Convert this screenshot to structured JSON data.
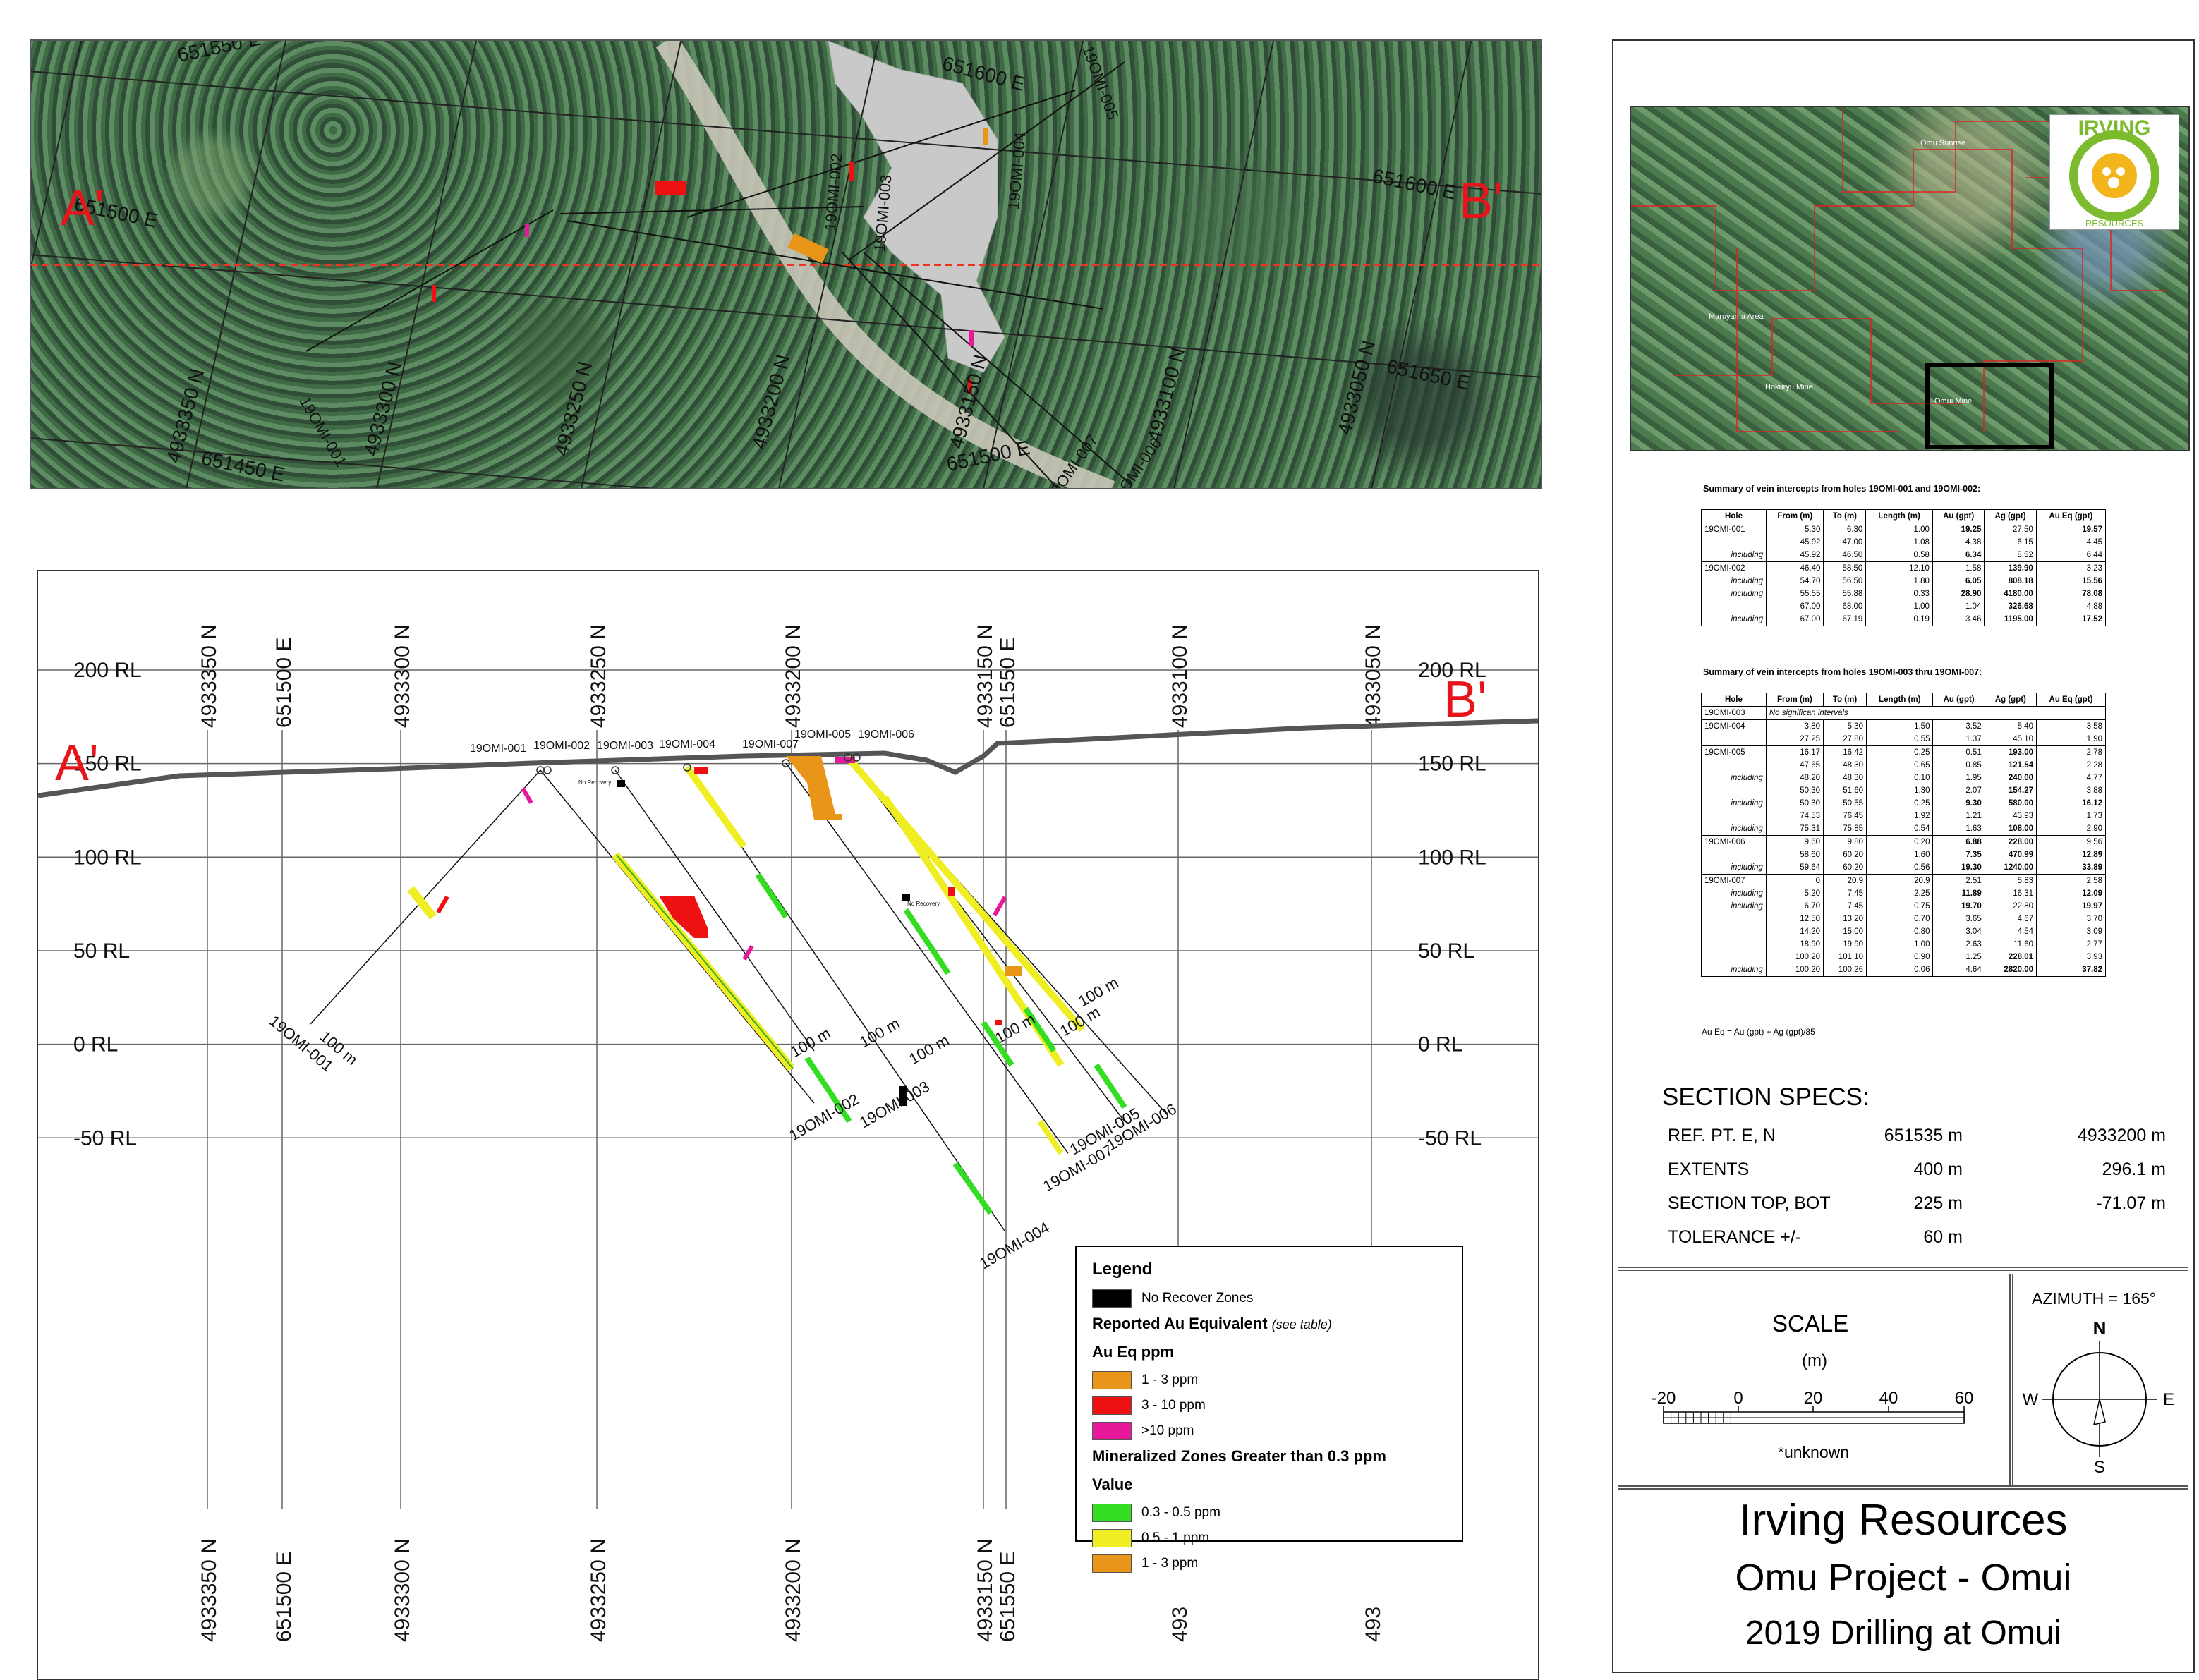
{
  "plan_map": {
    "section_start": "A'",
    "section_end": "B'",
    "grid_labels": [
      "651550 E",
      "651600 E",
      "651500 E",
      "651450 E",
      "651650 E",
      "4933350 N",
      "4933300 N",
      "4933250 N",
      "4933200 N",
      "4933150 N",
      "4933100 N",
      "4933050 N",
      "651500 E",
      "651600 E"
    ],
    "hole_labels": [
      "19OMI-001",
      "19OMI-002",
      "19OMI-003",
      "19OMI-004",
      "19OMI-005",
      "19OMI-006",
      "19OMI-007"
    ]
  },
  "section": {
    "start_label": "A'",
    "end_label": "B'",
    "rl_labels": [
      {
        "text": "200 RL",
        "rl": 200
      },
      {
        "text": "150 RL",
        "rl": 150
      },
      {
        "text": "100 RL",
        "rl": 100
      },
      {
        "text": "50 RL",
        "rl": 50
      },
      {
        "text": "0 RL",
        "rl": 0
      },
      {
        "text": "-50 RL",
        "rl": -50
      }
    ],
    "grid_labels": [
      "4933350 N",
      "651500 E",
      "4933300 N",
      "4933250 N",
      "4933200 N",
      "4933150 N",
      "651550 E",
      "4933100 N",
      "4933050 N"
    ],
    "bottom_grid_labels": [
      "4933350 N",
      "651500 E",
      "4933300 N",
      "4933250 N",
      "4933200 N",
      "4933150 N",
      "651550 E",
      "493",
      "493"
    ],
    "collar_labels": [
      "19OMI-001",
      "19OMI-002",
      "19OMI-003",
      "19OMI-004",
      "19OMI-007",
      "19OMI-005",
      "19OMI-006"
    ],
    "end_labels": [
      "19OMI-001",
      "19OMI-002",
      "19OMI-003",
      "19OMI-004",
      "19OMI-007",
      "19OMI-005",
      "19OMI-006"
    ],
    "depth_label": "100 m",
    "no_recovery": "No Recovery"
  },
  "legend": {
    "title": "Legend",
    "no_recover": "No Recover Zones",
    "au_title": "Reported Au Equivalent",
    "au_note": "(see table)",
    "au_sub": "Au Eq ppm",
    "au_items": [
      {
        "label": "1 - 3 ppm",
        "color": "#e8951a"
      },
      {
        "label": "3 - 10 ppm",
        "color": "#ee1111"
      },
      {
        "label": ">10 ppm",
        "color": "#e8189a"
      }
    ],
    "min_title": "Mineralized Zones Greater than 0.3 ppm",
    "min_sub": "Value",
    "min_items": [
      {
        "label": "0.3 - 0.5 ppm",
        "color": "#33dd22"
      },
      {
        "label": "0.5 - 1  ppm",
        "color": "#eeee22"
      },
      {
        "label": "1 - 3 ppm",
        "color": "#e8951a"
      }
    ]
  },
  "location_map": {
    "labels": [
      "Omu Sunrise",
      "Maruyama Area",
      "Hokuryu Mine",
      "Omui Mine"
    ],
    "logo_text": "IRVING",
    "logo_sub": "RESOURCES"
  },
  "table1": {
    "title": "Summary of vein intercepts from holes 19OMI-001 and 19OMI-002:",
    "headers": [
      "Hole",
      "From (m)",
      "To (m)",
      "Length (m)",
      "Au (gpt)",
      "Ag (gpt)",
      "Au Eq (gpt)"
    ],
    "rows": [
      [
        "19OMI-001",
        "5.30",
        "6.30",
        "1.00",
        "19.25",
        "27.50",
        "19.57"
      ],
      [
        "",
        "45.92",
        "47.00",
        "1.08",
        "4.38",
        "6.15",
        "4.45"
      ],
      [
        "including",
        "45.92",
        "46.50",
        "0.58",
        "6.34",
        "8.52",
        "6.44"
      ],
      [
        "19OMI-002",
        "46.40",
        "58.50",
        "12.10",
        "1.58",
        "139.90",
        "3.23"
      ],
      [
        "including",
        "54.70",
        "56.50",
        "1.80",
        "6.05",
        "808.18",
        "15.56"
      ],
      [
        "including",
        "55.55",
        "55.88",
        "0.33",
        "28.90",
        "4180.00",
        "78.08"
      ],
      [
        "",
        "67.00",
        "68.00",
        "1.00",
        "1.04",
        "326.68",
        "4.88"
      ],
      [
        "including",
        "67.00",
        "67.19",
        "0.19",
        "3.46",
        "1195.00",
        "17.52"
      ]
    ]
  },
  "table2": {
    "title": "Summary of vein intercepts from holes 19OMI-003 thru 19OMI-007:",
    "headers": [
      "Hole",
      "From (m)",
      "To (m)",
      "Length (m)",
      "Au (gpt)",
      "Ag (gpt)",
      "Au Eq (gpt)"
    ],
    "no_sig": "No significan intervals",
    "rows": [
      [
        "19OMI-004",
        "3.80",
        "5.30",
        "1.50",
        "3.52",
        "5.40",
        "3.58"
      ],
      [
        "",
        "27.25",
        "27.80",
        "0.55",
        "1.37",
        "45.10",
        "1.90"
      ],
      [
        "19OMI-005",
        "16.17",
        "16.42",
        "0.25",
        "0.51",
        "193.00",
        "2.78"
      ],
      [
        "",
        "47.65",
        "48.30",
        "0.65",
        "0.85",
        "121.54",
        "2.28"
      ],
      [
        "including",
        "48.20",
        "48.30",
        "0.10",
        "1.95",
        "240.00",
        "4.77"
      ],
      [
        "",
        "50.30",
        "51.60",
        "1.30",
        "2.07",
        "154.27",
        "3.88"
      ],
      [
        "including",
        "50.30",
        "50.55",
        "0.25",
        "9.30",
        "580.00",
        "16.12"
      ],
      [
        "",
        "74.53",
        "76.45",
        "1.92",
        "1.21",
        "43.93",
        "1.73"
      ],
      [
        "including",
        "75.31",
        "75.85",
        "0.54",
        "1.63",
        "108.00",
        "2.90"
      ],
      [
        "19OMI-006",
        "9.60",
        "9.80",
        "0.20",
        "6.88",
        "228.00",
        "9.56"
      ],
      [
        "",
        "58.60",
        "60.20",
        "1.60",
        "7.35",
        "470.99",
        "12.89"
      ],
      [
        "including",
        "59.64",
        "60.20",
        "0.56",
        "19.30",
        "1240.00",
        "33.89"
      ],
      [
        "19OMI-007",
        "0",
        "20.9",
        "20.9",
        "2.51",
        "5.83",
        "2.58"
      ],
      [
        "including",
        "5.20",
        "7.45",
        "2.25",
        "11.89",
        "16.31",
        "12.09"
      ],
      [
        "including",
        "6.70",
        "7.45",
        "0.75",
        "19.70",
        "22.80",
        "19.97"
      ],
      [
        "",
        "12.50",
        "13.20",
        "0.70",
        "3.65",
        "4.67",
        "3.70"
      ],
      [
        "",
        "14.20",
        "15.00",
        "0.80",
        "3.04",
        "4.54",
        "3.09"
      ],
      [
        "",
        "18.90",
        "19.90",
        "1.00",
        "2.63",
        "11.60",
        "2.77"
      ],
      [
        "",
        "100.20",
        "101.10",
        "0.90",
        "1.25",
        "228.01",
        "3.93"
      ],
      [
        "including",
        "100.20",
        "100.26",
        "0.06",
        "4.64",
        "2820.00",
        "37.82"
      ]
    ],
    "footnote": "Au Eq = Au (gpt) + Ag (gpt)/85"
  },
  "specs": {
    "title": "SECTION  SPECS:",
    "rows": [
      {
        "label": "REF. PT.  E, N",
        "a": "651535 m",
        "b": "4933200 m"
      },
      {
        "label": "EXTENTS",
        "a": "400 m",
        "b": "296.1 m"
      },
      {
        "label": "SECTION TOP, BOT",
        "a": "225 m",
        "b": "-71.07 m"
      },
      {
        "label": "TOLERANCE  +/-",
        "a": "60 m",
        "b": ""
      }
    ]
  },
  "scale": {
    "title": "SCALE",
    "unit": "(m)",
    "ticks": [
      "-20",
      "0",
      "20",
      "40",
      "60"
    ],
    "note": "*unknown"
  },
  "compass": {
    "azimuth": "AZIMUTH = 165°",
    "n": "N",
    "s": "S",
    "e": "E",
    "w": "W"
  },
  "title_block": {
    "company": "Irving Resources",
    "project": "Omu Project - Omui",
    "subtitle": "2019 Drilling at Omui"
  }
}
